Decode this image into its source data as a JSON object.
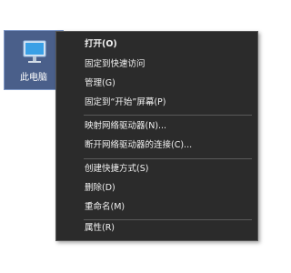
{
  "desktop_icon": {
    "label": "此电脑",
    "icon": "computer-icon"
  },
  "context_menu": {
    "groups": [
      [
        {
          "label": "打开(O)",
          "bold": true
        },
        {
          "label": "固定到快速访问"
        },
        {
          "label": "管理(G)"
        },
        {
          "label": "固定到“开始”屏幕(P)"
        }
      ],
      [
        {
          "label": "映射网络驱动器(N)..."
        },
        {
          "label": "断开网络驱动器的连接(C)..."
        }
      ],
      [
        {
          "label": "创建快捷方式(S)"
        },
        {
          "label": "删除(D)"
        },
        {
          "label": "重命名(M)"
        }
      ],
      [
        {
          "label": "属性(R)"
        }
      ]
    ]
  },
  "colors": {
    "menu_background": "#2b2b2b",
    "menu_text": "#f2f2f2",
    "separator": "#5a5a5a",
    "icon_selection": "#4a5f8a"
  }
}
